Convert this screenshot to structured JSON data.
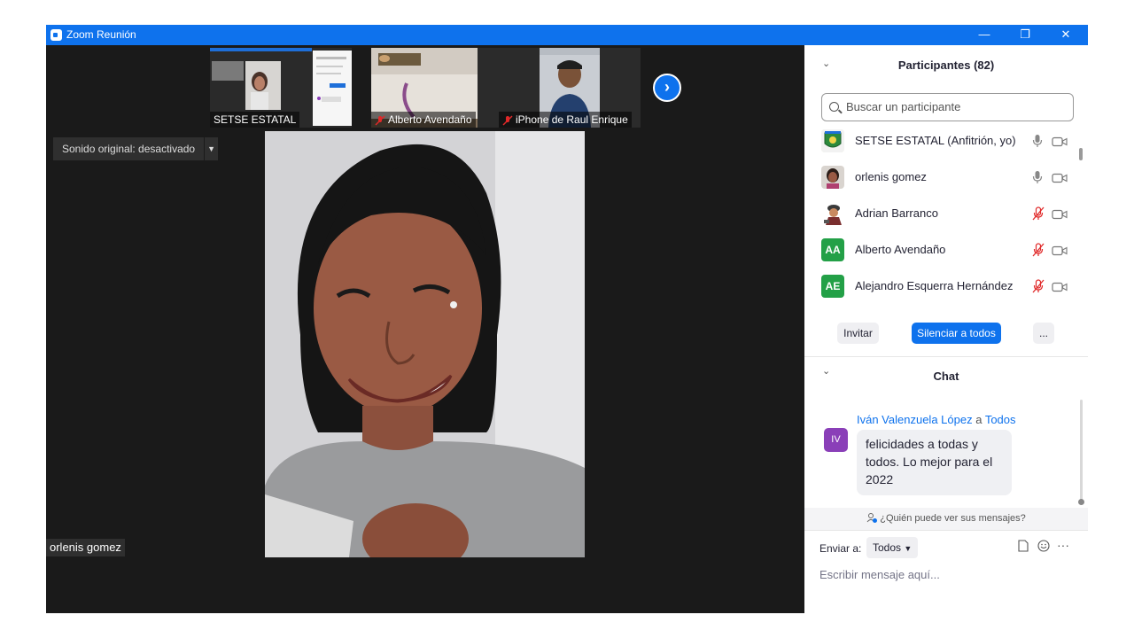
{
  "window": {
    "title": "Zoom Reunión",
    "controls": {
      "minimize": "—",
      "restore": "❐",
      "close": "✕"
    }
  },
  "thumbnails": [
    {
      "name": "SETSE ESTATAL",
      "muted": false
    },
    {
      "name": "Alberto Avendaño",
      "muted": true
    },
    {
      "name": "iPhone de Raul Enrique",
      "muted": true
    }
  ],
  "next_button": "›",
  "sound_toggle": {
    "label": "Sonido original: desactivado",
    "arrow": "▼"
  },
  "active_speaker": {
    "name": "orlenis gomez"
  },
  "participants": {
    "title": "Participantes (82)",
    "chevron": "⌄",
    "search_placeholder": "Buscar un participante",
    "list": [
      {
        "name": "SETSE ESTATAL (Anfitrión, yo)",
        "mic": "on",
        "avatar_type": "logo"
      },
      {
        "name": "orlenis gomez",
        "mic": "on",
        "avatar_type": "photo"
      },
      {
        "name": "Adrian Barranco",
        "mic": "muted",
        "avatar_type": "cartoon"
      },
      {
        "name": "Alberto Avendaño",
        "mic": "muted",
        "avatar_type": "initials",
        "initials": "AA",
        "color": "#23a047"
      },
      {
        "name": "Alejandro Esquerra Hernández",
        "mic": "muted",
        "avatar_type": "initials",
        "initials": "AE",
        "color": "#23a047"
      }
    ],
    "buttons": {
      "invite": "Invitar",
      "mute_all": "Silenciar a todos",
      "more": "..."
    }
  },
  "chat": {
    "title": "Chat",
    "chevron": "⌄",
    "messages": [
      {
        "author": "Iván Valenzuela López",
        "to_word": "a",
        "to": "Todos",
        "initials": "IV",
        "text": "felicidades a todas y todos. Lo mejor para el 2022"
      }
    ],
    "who_can_see": "¿Quién puede ver sus mensajes?",
    "send_to_label": "Enviar a:",
    "send_to_value": "Todos",
    "input_placeholder": "Escribir mensaje aquí..."
  },
  "colors": {
    "accent": "#0e72ed",
    "background": "#1a1a1a",
    "muted_red": "#e02828",
    "initials_green": "#23a047",
    "chat_avatar": "#8a3fb8"
  }
}
